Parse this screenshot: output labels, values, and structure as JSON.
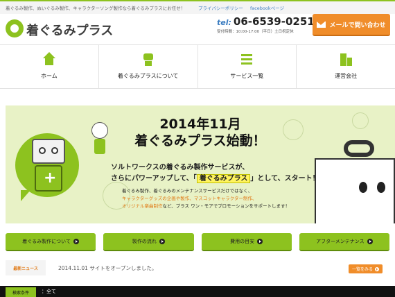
{
  "topbar": {
    "tagline": "着ぐるみ製作、ぬいぐるみ製作、キャラクターソング製作なら着ぐるみプラスにお任せ！",
    "privacy": "プライバシーポリシー",
    "facebook": "facebookページ"
  },
  "header": {
    "logo_text": "着ぐるみプラス",
    "tel_prefix": "tel:",
    "tel_number": "06-6539-0251",
    "hours": "受付時間：10:00-17:00（平日）土日祝定休",
    "mail_button": "メールで問い合わせ"
  },
  "nav": [
    {
      "label": "ホーム",
      "icon": "home-icon"
    },
    {
      "label": "着ぐるみプラスについて",
      "icon": "robot-icon"
    },
    {
      "label": "サービス一覧",
      "icon": "list-icon"
    },
    {
      "label": "運営会社",
      "icon": "building-icon"
    }
  ],
  "hero": {
    "headline1": "2014年11月",
    "headline2": "着ぐるみプラス始動！",
    "lead1": "ソルトワークスの着ぐるみ製作サービスが、",
    "lead2_pre": "さらにパワーアップして、「",
    "lead2_hl": "着ぐるみプラス",
    "lead2_post": "」として、スタート！",
    "desc1": "着ぐるみ製作、着ぐるみのメンテナンスサービスだけではなく、",
    "desc2": "キャラクターグッズの企画や製作、マスコットキャラクター制作、",
    "desc3_or": "オリジナル楽曲制作",
    "desc3_rest": "など、プラス ワン・モアでプロモーションをサポートします！"
  },
  "categories": [
    {
      "label": "着ぐるみ製作について"
    },
    {
      "label": "製作の流れ"
    },
    {
      "label": "費用の目安"
    },
    {
      "label": "アフターメンテナンス"
    }
  ],
  "news": {
    "label": "最新ニュース",
    "item": "2014.11.01  サイトをオープンしました。",
    "more": "一覧をみる"
  },
  "search": {
    "label": "検索条件",
    "value": "：全て"
  },
  "colors": {
    "accent": "#8dc21f",
    "orange": "#f08d2a",
    "hero_bg": "#e8f2c6"
  }
}
